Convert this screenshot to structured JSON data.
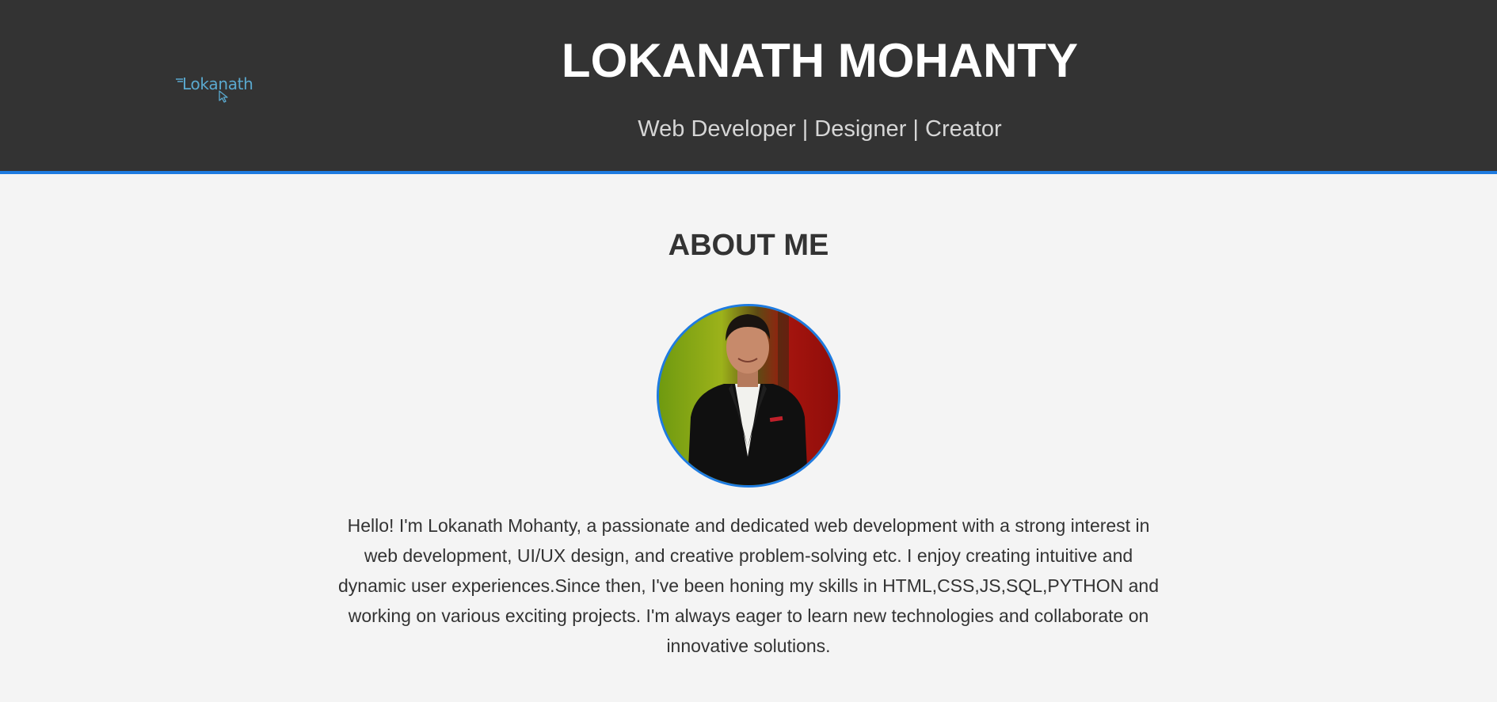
{
  "header": {
    "logo": {
      "text": "Lokanath",
      "icon": "cursor-arrow-icon",
      "color": "#5aa9cf"
    },
    "title": "LOKANATH MOHANTY",
    "subtitle": "Web Developer | Designer | Creator"
  },
  "about": {
    "heading": "ABOUT ME",
    "photo": "profile-photo",
    "bio": "Hello! I'm Lokanath Mohanty, a passionate and dedicated web development with a strong interest in web development, UI/UX design, and creative problem-solving etc. I enjoy creating intuitive and dynamic user experiences.Since then, I've been honing my skills in HTML,CSS,JS,SQL,PYTHON and working on various exciting projects. I'm always eager to learn new technologies and collaborate on innovative solutions."
  },
  "colors": {
    "header_bg": "#333333",
    "accent": "#1e7be0",
    "page_bg": "#f4f4f4",
    "text": "#333333"
  }
}
